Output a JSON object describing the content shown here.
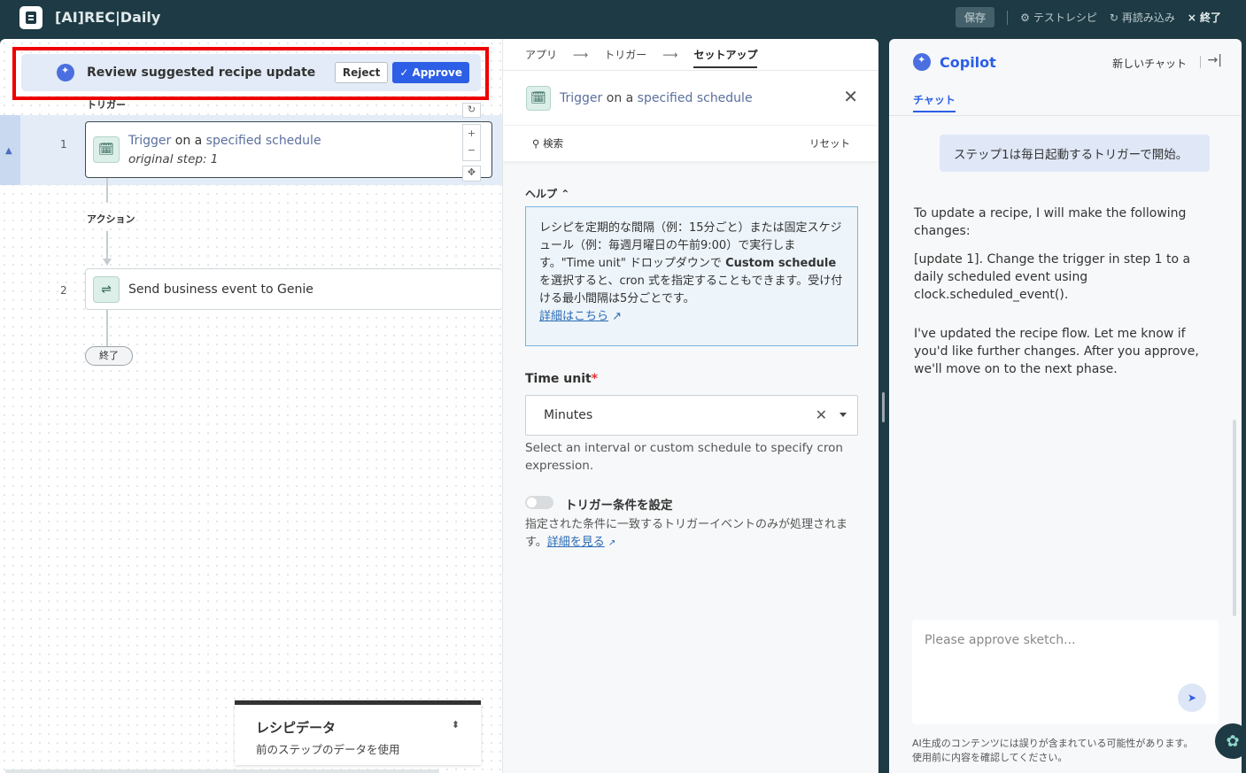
{
  "app": {
    "title": "[AI]REC|Daily"
  },
  "toolbar": {
    "save": "保存",
    "test": "テストレシピ",
    "reload": "再読み込み",
    "exit": "終了"
  },
  "review": {
    "text": "Review suggested recipe update",
    "reject": "Reject",
    "approve": "Approve"
  },
  "flow": {
    "trigger_label": "トリガー",
    "action_label": "アクション",
    "end_label": "終了",
    "step1": {
      "num": "1",
      "prefix": "Trigger",
      "mid": " on a ",
      "suffix": "specified schedule",
      "sub": "original step: 1"
    },
    "step2": {
      "num": "2",
      "text": "Send business event to Genie"
    }
  },
  "recipe_data": {
    "title": "レシピデータ",
    "subtitle": "前のステップのデータを使用"
  },
  "setup": {
    "crumbs": [
      "アプリ",
      "トリガー",
      "セットアップ"
    ],
    "trigger_prefix": "Trigger",
    "trigger_mid": " on a ",
    "trigger_suffix": "specified schedule",
    "search": "検索",
    "reset": "リセット",
    "help_title": "ヘルプ",
    "help_text_1": "レシピを定期的な間隔（例：15分ごと）または固定スケジュール（例：毎週月曜日の午前9:00）で実行します。\"Time unit\" ドロップダウンで ",
    "help_bold": "Custom schedule",
    "help_text_2": " を選択すると、cron 式を指定することもできます。受け付ける最小間隔は5分ごとです。",
    "help_link": "詳細はこちら",
    "time_unit_label": "Time unit",
    "time_unit_value": "Minutes",
    "time_unit_hint": "Select an interval or custom schedule to specify cron expression.",
    "trigger_cond_label": "トリガー条件を設定",
    "trigger_cond_desc": "指定された条件に一致するトリガーイベントのみが処理されます。",
    "trigger_cond_link": "詳細を見る"
  },
  "copilot": {
    "title": "Copilot",
    "new_chat": "新しいチャット",
    "tab": "チャット",
    "user_msg": "ステップ1は毎日起動するトリガーで開始。",
    "assistant_1": "To update a recipe, I will make the following changes:",
    "assistant_2": "[update 1]. Change the trigger in step 1 to a daily scheduled event using clock.scheduled_event().",
    "assistant_3": "I've updated the recipe flow. Let me know if you'd like further changes. After you approve, we'll move on to the next phase.",
    "input_placeholder": "Please approve sketch...",
    "disclaimer_1": "AI生成のコンテンツには誤りが含まれている可能性があります。",
    "disclaimer_2": "使用前に内容を確認してください。"
  }
}
